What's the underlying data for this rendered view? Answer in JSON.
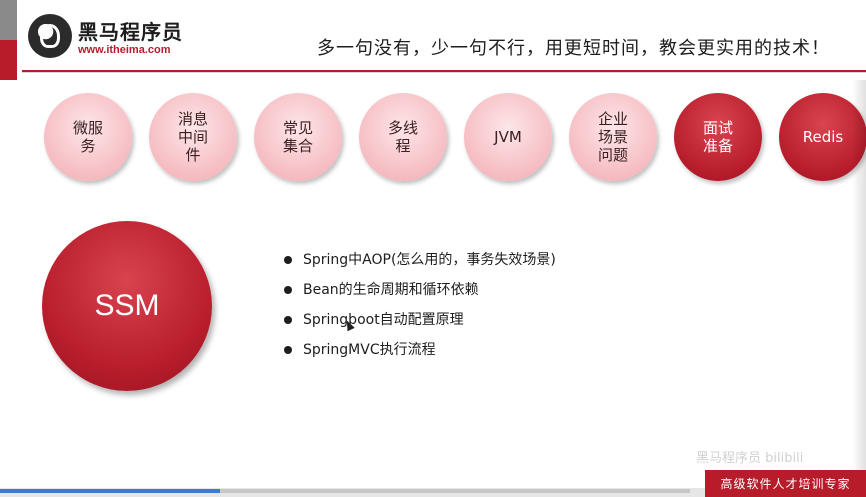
{
  "header": {
    "logo_name": "黑马程序员",
    "logo_url": "www.itheima.com",
    "slogan": "多一句没有，少一句不行，用更短时间，教会更实用的技术！"
  },
  "topics": [
    {
      "label": "微服\n务",
      "style": "light"
    },
    {
      "label": "消息\n中间\n件",
      "style": "light"
    },
    {
      "label": "常见\n集合",
      "style": "light"
    },
    {
      "label": "多线\n程",
      "style": "light"
    },
    {
      "label": "JVM",
      "style": "light"
    },
    {
      "label": "企业\n场景\n问题",
      "style": "light"
    },
    {
      "label": "面试\n准备",
      "style": "dark"
    },
    {
      "label": "Redis",
      "style": "dark"
    }
  ],
  "main": {
    "circle_label": "SSM",
    "bullets": [
      "Spring中AOP(怎么用的，事务失效场景)",
      "Bean的生命周期和循环依赖",
      "Springboot自动配置原理",
      "SpringMVC执行流程"
    ]
  },
  "footer": {
    "badge": "高级软件人才培训专家",
    "watermark": "黑马程序员 bilibili"
  },
  "colors": {
    "brand_red": "#b71c2b",
    "light_pink": "#f5b9bf"
  }
}
